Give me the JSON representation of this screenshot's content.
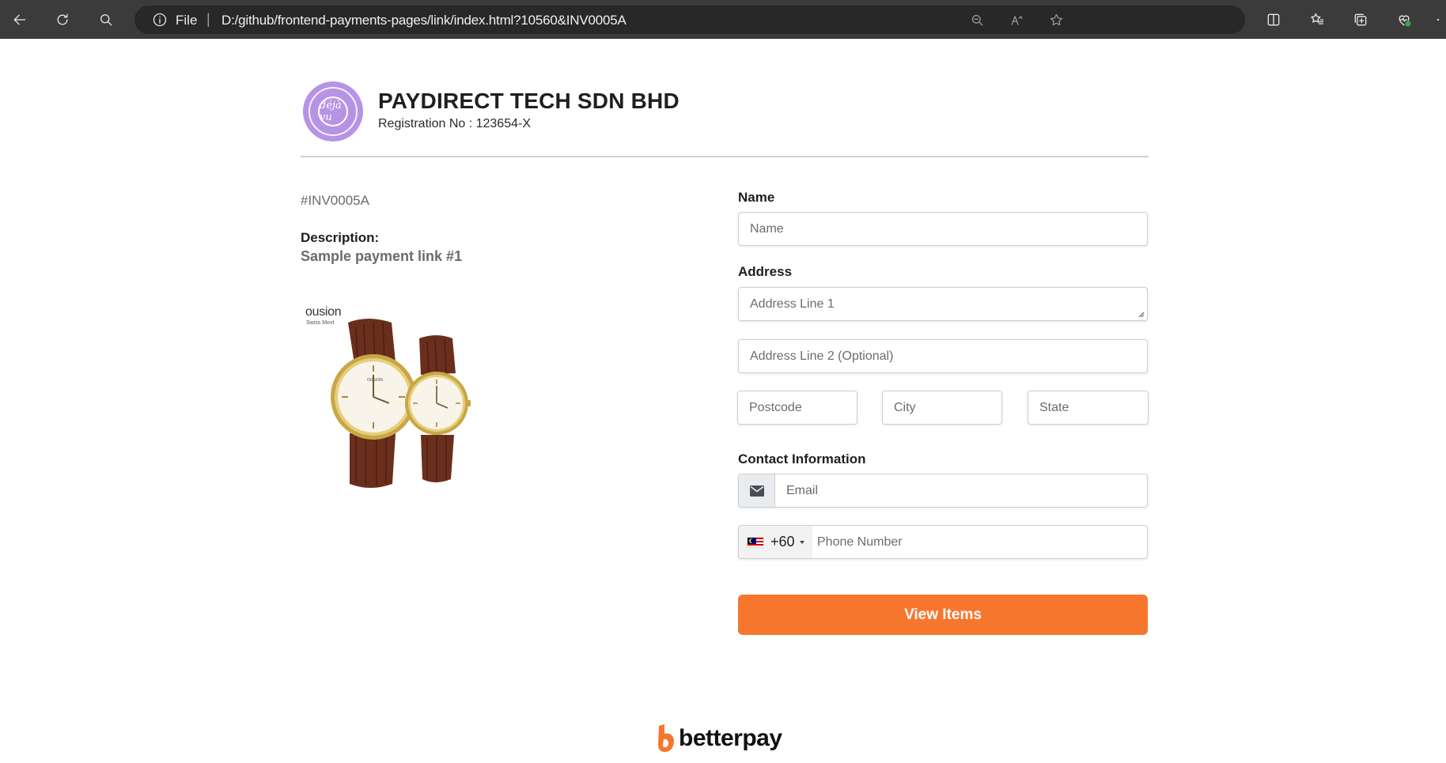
{
  "browser": {
    "address_prefix": "File",
    "url": "D:/github/frontend-payments-pages/link/index.html?10560&INV0005A"
  },
  "merchant": {
    "name": "PAYDIRECT TECH SDN BHD",
    "registration": "Registration No : 123654-X",
    "logo_text": "déjà vu",
    "logo_color": "#b793e6"
  },
  "invoice": {
    "number": "#INV0005A",
    "description_label": "Description:",
    "description": "Sample payment link #1"
  },
  "product": {
    "brand": "ousion",
    "brand_sub": "Swiss Movt"
  },
  "form": {
    "name_label": "Name",
    "name_placeholder": "Name",
    "address_label": "Address",
    "address1_placeholder": "Address Line 1",
    "address2_placeholder": "Address Line 2 (Optional)",
    "postcode_placeholder": "Postcode",
    "city_placeholder": "City",
    "state_placeholder": "State",
    "contact_label": "Contact Information",
    "email_placeholder": "Email",
    "dial_code": "+60",
    "phone_placeholder": "Phone Number",
    "submit_label": "View Items"
  },
  "footer": {
    "brand": "betterpay",
    "accent_color": "#f7762d"
  }
}
